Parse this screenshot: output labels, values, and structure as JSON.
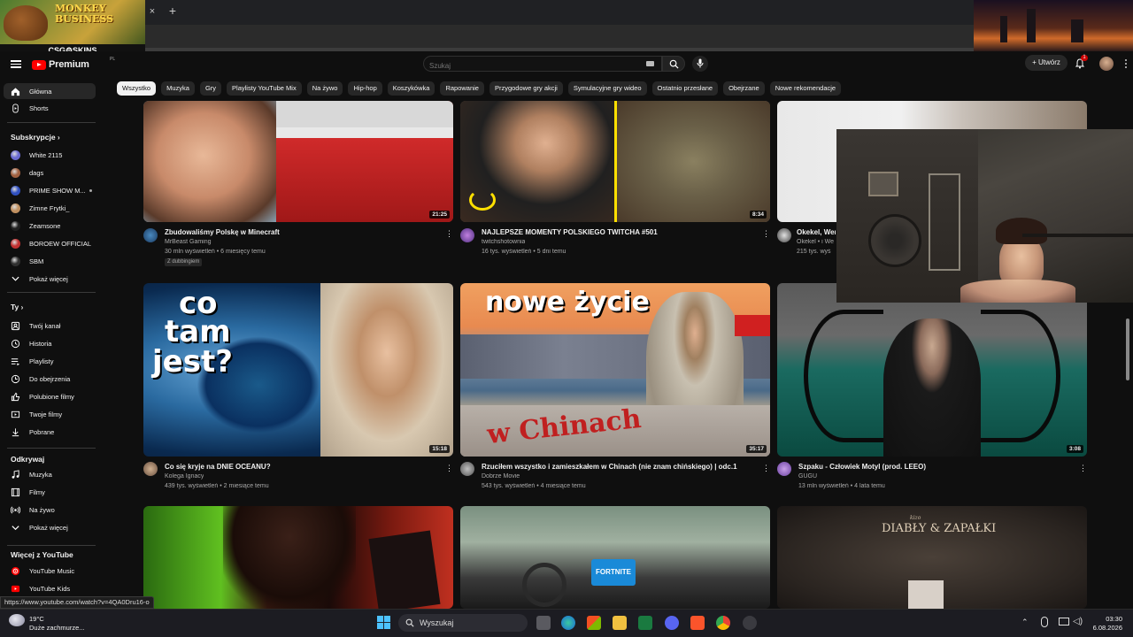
{
  "promo_left": {
    "title_line1": "MONKEY",
    "title_line2": "BUSINESS",
    "brand": "CSG⚙SKINS"
  },
  "browser": {
    "tab_close": "×",
    "new_tab": "+"
  },
  "header": {
    "logo_text": "Premium",
    "logo_region": "PL",
    "search_placeholder": "Szukaj",
    "create_label": "+ Utwórz",
    "notifications_badge": "1"
  },
  "chips": [
    "Wszystko",
    "Muzyka",
    "Gry",
    "Playlisty YouTube Mix",
    "Na żywo",
    "Hip-hop",
    "Koszykówka",
    "Rapowanie",
    "Przygodowe gry akcji",
    "Symulacyjne gry wideo",
    "Ostatnio przesłane",
    "Obejrzane",
    "Nowe rekomendacje"
  ],
  "sidebar": {
    "main": [
      {
        "label": "Główna",
        "icon": "home-icon"
      },
      {
        "label": "Shorts",
        "icon": "shorts-icon"
      }
    ],
    "subs_header": "Subskrypcje",
    "subs": [
      {
        "label": "White 2115",
        "color": "#6a6ad0"
      },
      {
        "label": "dags",
        "color": "#a06040"
      },
      {
        "label": "PRIME SHOW M...",
        "color": "#3050c0"
      },
      {
        "label": "Zimne Frytki_",
        "color": "#c09060"
      },
      {
        "label": "Zeamsone",
        "color": "#202020"
      },
      {
        "label": "BOROEW OFFICIAL",
        "color": "#c03030"
      },
      {
        "label": "SBM",
        "color": "#303030"
      }
    ],
    "show_more": "Pokaż więcej",
    "you_header": "Ty",
    "you": [
      {
        "label": "Twój kanał",
        "icon": "channel-icon"
      },
      {
        "label": "Historia",
        "icon": "history-icon"
      },
      {
        "label": "Playlisty",
        "icon": "playlist-icon"
      },
      {
        "label": "Do obejrzenia",
        "icon": "watch-later-icon"
      },
      {
        "label": "Polubione filmy",
        "icon": "like-icon"
      },
      {
        "label": "Twoje filmy",
        "icon": "your-videos-icon"
      },
      {
        "label": "Pobrane",
        "icon": "download-icon"
      }
    ],
    "explore_header": "Odkrywaj",
    "explore": [
      {
        "label": "Muzyka",
        "icon": "music-icon"
      },
      {
        "label": "Filmy",
        "icon": "movies-icon"
      },
      {
        "label": "Na żywo",
        "icon": "live-icon"
      },
      {
        "label": "Pokaż więcej",
        "icon": "chevron-down-icon"
      }
    ],
    "more_header": "Więcej z YouTube",
    "more": [
      {
        "label": "YouTube Music",
        "icon": "yt-music-icon"
      },
      {
        "label": "YouTube Kids",
        "icon": "yt-kids-icon"
      }
    ]
  },
  "videos": {
    "row1": [
      {
        "title": "Zbudowaliśmy Polskę w Minecraft",
        "channel": "MrBeast Gaming",
        "stats": "30 mln wyświetleń • 6 miesięcy temu",
        "duration": "21:25",
        "dub": "Z dubbingiem"
      },
      {
        "title": "NAJLEPSZE MOMENTY POLSKIEGO TWITCHA #501",
        "channel": "twitchshotownia",
        "stats": "16 tys. wyświetleń • 5 dni temu",
        "duration": "8:34"
      },
      {
        "title": "Okekel, Wen",
        "channel": "Okekel • i We",
        "stats": "215 tys. wyś"
      }
    ],
    "row2": [
      {
        "title": "Co się kryje na DNIE OCEANU?",
        "channel": "Kolega Ignacy",
        "stats": "439 tys. wyświetleń • 2 miesiące temu",
        "duration": "15:18",
        "thumb_text": [
          "co",
          "tam",
          "jest?"
        ]
      },
      {
        "title": "Rzuciłem wszystko i zamieszkałem w Chinach (nie znam chińskiego) | odc.1",
        "channel": "Dobrze Movie",
        "stats": "543 tys. wyświetleń • 4 miesiące temu",
        "duration": "35:17",
        "thumb_text": "nowe życie",
        "thumb_sub": "w Chinach"
      },
      {
        "title": "Szpaku - Człowiek Motyl (prod. LEEO)",
        "channel": "GUGU",
        "stats": "13 mln wyświetleń • 4 lata temu",
        "duration": "3:08"
      }
    ],
    "row3": [
      {
        "thumb": "art"
      },
      {
        "thumb": "car",
        "badge": "FORTNITE"
      },
      {
        "thumb": "album",
        "text": "DIABŁY & ZAPAŁKI",
        "script": "kizo"
      }
    ]
  },
  "status_url": "https://www.youtube.com/watch?v=4QA0Dru16-o",
  "taskbar": {
    "temp": "19°C",
    "weather": "Duże zachmurze...",
    "search": "Wyszukaj",
    "time": "03:30",
    "date": "6.08.2026"
  }
}
